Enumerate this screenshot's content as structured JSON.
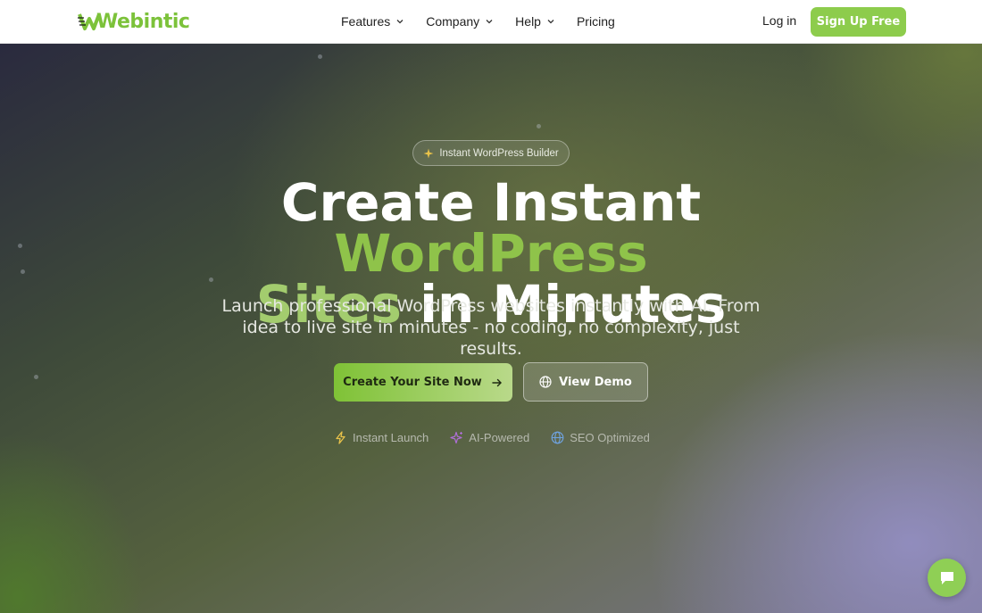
{
  "header": {
    "logo_text": "Webintic",
    "nav": [
      {
        "label": "Features",
        "has_dropdown": true
      },
      {
        "label": "Company",
        "has_dropdown": true
      },
      {
        "label": "Help",
        "has_dropdown": true
      },
      {
        "label": "Pricing",
        "has_dropdown": false
      }
    ],
    "login_label": "Log in",
    "signup_label": "Sign Up Free"
  },
  "hero": {
    "badge": {
      "icon": "sparkle-icon",
      "text": "Instant WordPress Builder"
    },
    "title": {
      "part1": "Create Instant ",
      "highlight1": "WordPress",
      "highlight2": "Sites",
      "part2": " in Minutes"
    },
    "subtitle": "Launch professional WordPress websites instantly with AI. From idea to live site in minutes - no coding, no complexity, just results.",
    "primary_button": {
      "label": "Create Your Site Now",
      "icon": "arrow-right-icon"
    },
    "secondary_button": {
      "label": "View Demo",
      "icon": "globe-icon"
    },
    "features": [
      {
        "label": "Instant Launch",
        "icon": "lightning-icon"
      },
      {
        "label": "AI-Powered",
        "icon": "sparkle-icon"
      },
      {
        "label": "SEO Optimized",
        "icon": "globe-icon"
      }
    ]
  },
  "chat_widget": {
    "icon": "chat-icon"
  },
  "colors": {
    "brand_green": "#7cc23a",
    "signup_button": "#8dcc4c",
    "highlight_text": "#8fc34a",
    "chat_button": "#8fcf55"
  }
}
